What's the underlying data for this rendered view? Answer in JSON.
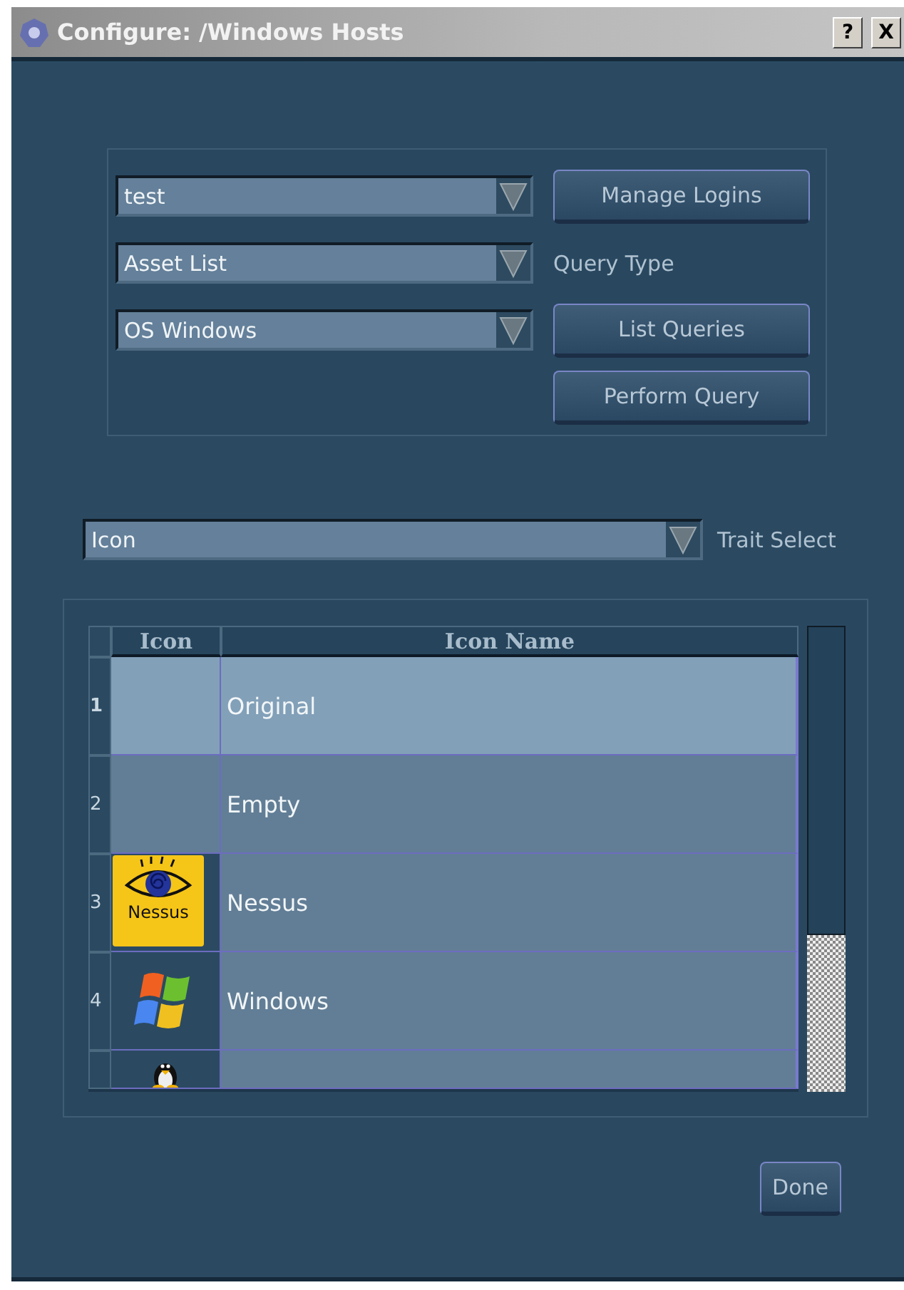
{
  "window": {
    "title": "Configure: /Windows Hosts",
    "help_button": "?",
    "close_button": "X"
  },
  "query_panel": {
    "rows": [
      {
        "dropdown": "test",
        "action": {
          "kind": "button",
          "text": "Manage Logins"
        }
      },
      {
        "dropdown": "Asset List",
        "action": {
          "kind": "label",
          "text": "Query Type"
        }
      },
      {
        "dropdown": "OS Windows",
        "action": {
          "kind": "button",
          "text": "List Queries"
        }
      },
      {
        "action": {
          "kind": "button",
          "text": "Perform Query"
        }
      }
    ]
  },
  "trait": {
    "value": "Icon",
    "label": "Trait Select"
  },
  "table": {
    "columns": [
      "Icon",
      "Icon Name"
    ],
    "rows": [
      {
        "kind": "blank",
        "number": "1",
        "name": "Original",
        "selected": true
      },
      {
        "kind": "blank",
        "number": "2",
        "name": "Empty",
        "selected": false
      },
      {
        "kind": "eye",
        "icon_text": "Nessus",
        "number": "3",
        "name": "Nessus",
        "selected": false
      },
      {
        "kind": "flag",
        "number": "4",
        "name": "Windows",
        "selected": false
      },
      {
        "kind": "penguin",
        "selected": false
      }
    ]
  },
  "done_button": "Done"
}
